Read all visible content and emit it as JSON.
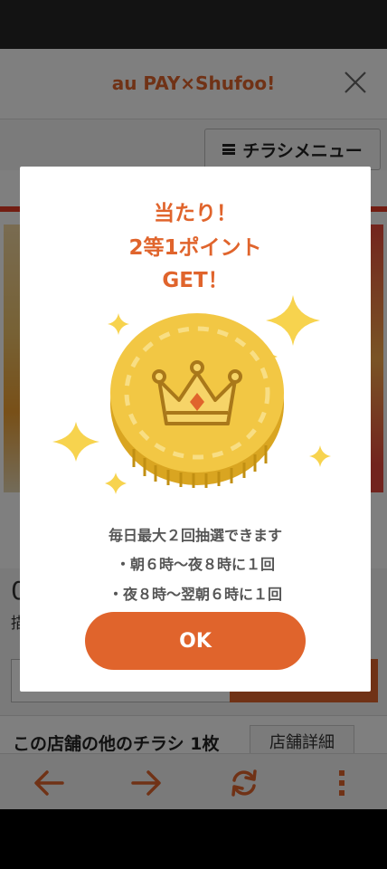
{
  "header": {
    "title": "au PAY×Shufoo!"
  },
  "subbar": {
    "menu_label": "チラシメニュー"
  },
  "background": {
    "price_partial": "0",
    "price_sub_partial": "描",
    "store_row_text": "この店舗の他のチラシ 1枚",
    "store_detail_label": "店舗詳細"
  },
  "modal": {
    "result_line1": "当たり！",
    "result_line2": "2等1ポイント",
    "result_line3": "GET！",
    "info_line1": "毎日最大２回抽選できます",
    "info_line2": "・朝６時〜夜８時に１回",
    "info_line3": "・夜８時〜翌朝６時に１回",
    "ok_label": "OK"
  },
  "nav": {
    "icons": [
      "back-arrow-icon",
      "forward-arrow-icon",
      "refresh-icon",
      "more-vertical-icon"
    ]
  },
  "colors": {
    "accent": "#e0642c",
    "coin": "#f2c744",
    "sparkle": "#f7d34e",
    "overlay": "rgba(0,0,0,0.5)"
  }
}
